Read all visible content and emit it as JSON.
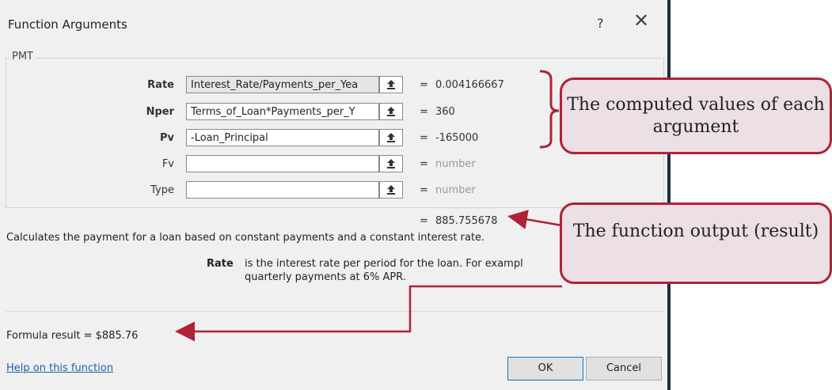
{
  "dialog": {
    "title": "Function Arguments",
    "help_label": "?",
    "close_label": "✕",
    "function_name": "PMT",
    "arguments": [
      {
        "name": "Rate",
        "value": "Interest_Rate/Payments_per_Yea",
        "computed": "0.004166667"
      },
      {
        "name": "Nper",
        "value": "Terms_of_Loan*Payments_per_Y",
        "computed": "360"
      },
      {
        "name": "Pv",
        "value": "-Loan_Principal",
        "computed": "-165000"
      },
      {
        "name": "Fv",
        "value": "",
        "computed": "number"
      },
      {
        "name": "Type",
        "value": "",
        "computed": "number"
      }
    ],
    "result_equals": "=",
    "result_value": "885.755678",
    "description": "Calculates the payment for a loan based on constant payments and a constant interest rate.",
    "param_name": "Rate",
    "param_desc_line1": "is the interest rate per period for the loan. For exampl",
    "param_desc_line2": "quarterly payments at 6% APR.",
    "formula_result": "Formula result =   $885.76",
    "help_link": "Help on this function",
    "ok_label": "OK",
    "cancel_label": "Cancel"
  },
  "annotations": {
    "computed_values": "The computed values of each argument",
    "function_output": "The function output (result)"
  },
  "colors": {
    "dialog_bg": "#f0f0f0",
    "annotation_fill": "#ecdfe5",
    "annotation_border": "#b02235",
    "arrow": "#b02235",
    "link": "#1a5fb4"
  },
  "icons": {
    "collapse": "collapse-arrow-icon",
    "close": "close-icon"
  }
}
